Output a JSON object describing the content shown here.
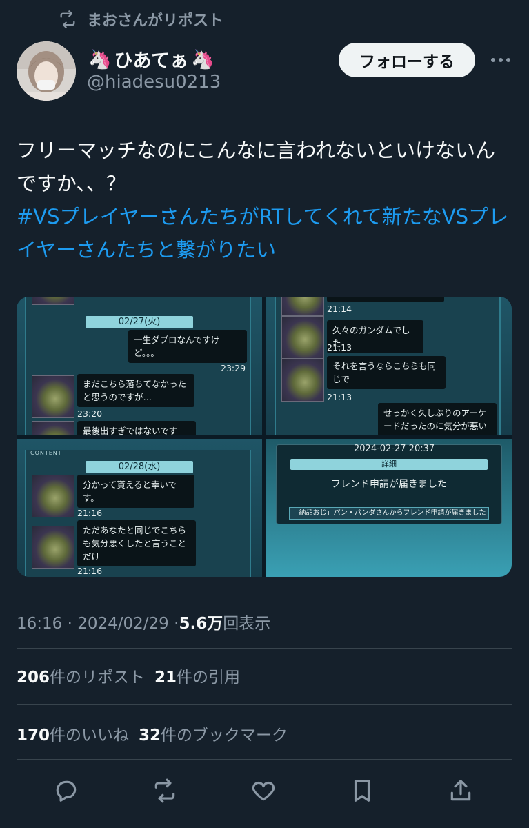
{
  "repost_header": {
    "text": "まおさんがリポスト",
    "icon": "repost-icon"
  },
  "author": {
    "name_emoji": "🦄",
    "name": "ひあてぁ",
    "handle": "@hiadesu0213",
    "avatar": "avatar-photo"
  },
  "follow_label": "フォローする",
  "tweet": {
    "text_line": "フリーマッチなのにこんなに言われないといけないんですか、、？",
    "hashtag": "#VSプレイヤーさんたちがRTしてくれて新たなVSプレイヤーさんたちと繋がりたい"
  },
  "media": {
    "panel1": {
      "date": "02/27(火)",
      "msg1": "一生ダブロなんですけど。。。",
      "time1": "23:29",
      "msg2": "まだこちら落ちてなかったと思うのですが…",
      "time2": "23:20",
      "msg3": "最後出すぎではないです"
    },
    "panel2": {
      "time0": "21:14",
      "msg1": "久々のガンダムでした",
      "time1": "21:13",
      "msg2": "それを言うならこちらも同じで",
      "time2": "21:13",
      "msg3": "せっかく久しぶりのアーケードだったのに気分が悪い"
    },
    "panel3": {
      "label": "CONTENT",
      "date": "02/28(水)",
      "msg1": "分かって貰えると幸いです。",
      "time1": "21:16",
      "msg2": "ただあなたと同じでこちらも気分悪くしたと言うことだけ",
      "time2": "21:16"
    },
    "panel4": {
      "datetime": "2024-02-27 20:37",
      "bar": "詳細",
      "message": "フレンド申請が届きました",
      "note": "「納品おじ」パン・パンダさんからフレンド申請が届きました"
    }
  },
  "meta": {
    "time": "16:16",
    "sep": "·",
    "date": "2024/02/29",
    "views_count": "5.6万",
    "views_label": "回表示"
  },
  "stats1": {
    "reposts_count": "206",
    "reposts_label": "件のリポスト",
    "quotes_count": "21",
    "quotes_label": "件の引用"
  },
  "stats2": {
    "likes_count": "170",
    "likes_label": "件のいいね",
    "bookmarks_count": "32",
    "bookmarks_label": "件のブックマーク"
  },
  "colors": {
    "background": "#15202b",
    "text": "#f7f9f9",
    "secondary": "#8b98a5",
    "link": "#1d9bf0"
  }
}
